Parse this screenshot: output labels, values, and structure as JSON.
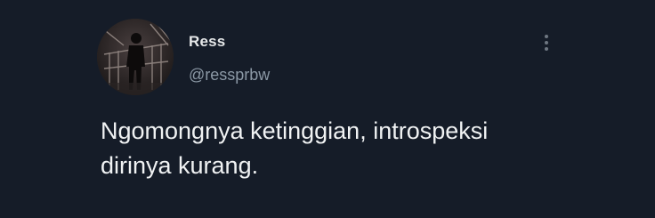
{
  "tweet": {
    "author": {
      "display_name": "Ress",
      "handle": "@ressprbw",
      "avatar_icon": "profile-photo"
    },
    "more_icon": "vertical-ellipsis-icon",
    "text": "Ngomongnya ketinggian, introspeksi\ndirinya kurang.",
    "colors": {
      "background": "#151c28",
      "text": "#f0f2f3",
      "handle": "#8b98a5"
    }
  }
}
